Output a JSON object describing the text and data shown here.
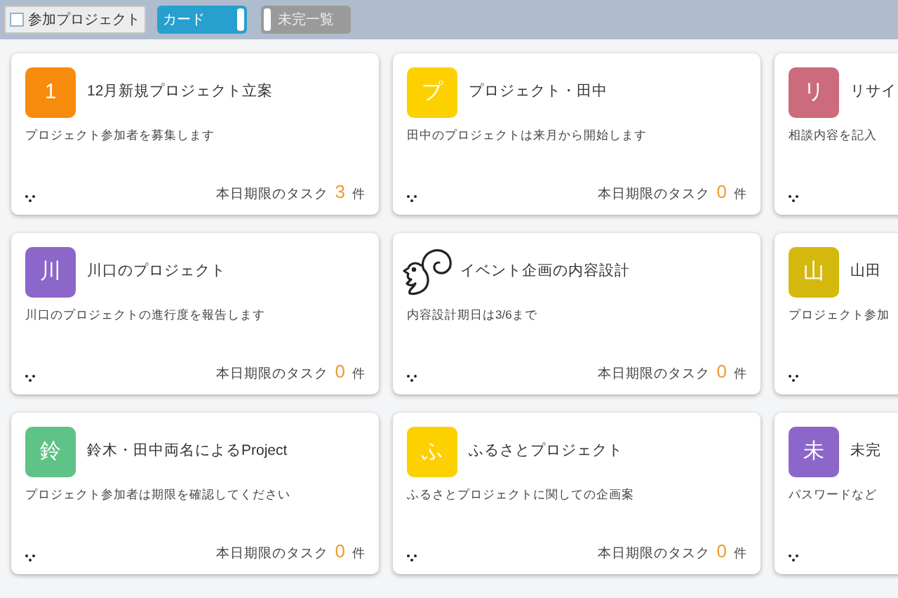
{
  "toolbar": {
    "filter": {
      "label": "参加プロジェクト",
      "checked": false
    },
    "toggles": [
      {
        "label": "カード",
        "on": true
      },
      {
        "label": "未完一覧",
        "on": false
      }
    ]
  },
  "projects": [
    {
      "kind": "letter",
      "avatar": "1",
      "color": "#f68b0e",
      "title": "12月新規プロジェクト立案",
      "description": "プロジェクト参加者を募集します",
      "task_label": "本日期限のタスク",
      "task_count": "3",
      "task_unit": "件"
    },
    {
      "kind": "letter",
      "avatar": "プ",
      "color": "#fdd100",
      "title": "プロジェクト・田中",
      "description": "田中のプロジェクトは来月から開始します",
      "task_label": "本日期限のタスク",
      "task_count": "0",
      "task_unit": "件"
    },
    {
      "kind": "letter",
      "avatar": "リ",
      "color": "#cc6b7b",
      "title": "リサイ",
      "description": "相談内容を記入"
    },
    {
      "kind": "letter",
      "avatar": "川",
      "color": "#8c67c9",
      "title": "川口のプロジェクト",
      "description": "川口のプロジェクトの進行度を報告します",
      "task_label": "本日期限のタスク",
      "task_count": "0",
      "task_unit": "件"
    },
    {
      "kind": "icon",
      "title": "イベント企画の内容設計",
      "description": "内容設計期日は3/6まで",
      "task_label": "本日期限のタスク",
      "task_count": "0",
      "task_unit": "件"
    },
    {
      "kind": "letter",
      "avatar": "山",
      "color": "#d4b80e",
      "title": "山田",
      "description": "プロジェクト参加"
    },
    {
      "kind": "letter",
      "avatar": "鈴",
      "color": "#5fc286",
      "title": "鈴木・田中両名によるProject",
      "description": "プロジェクト参加者は期限を確認してください",
      "task_label": "本日期限のタスク",
      "task_count": "0",
      "task_unit": "件"
    },
    {
      "kind": "letter",
      "avatar": "ふ",
      "color": "#fdd100",
      "title": "ふるさとプロジェクト",
      "description": "ふるさとプロジェクトに関しての企画案",
      "task_label": "本日期限のタスク",
      "task_count": "0",
      "task_unit": "件"
    },
    {
      "kind": "letter",
      "avatar": "未",
      "color": "#8c67c9",
      "title": "未完",
      "description": "パスワードなど"
    }
  ]
}
